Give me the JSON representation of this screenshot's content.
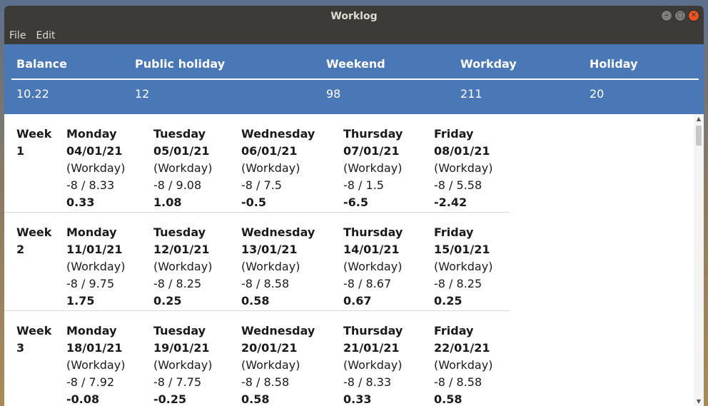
{
  "window": {
    "title": "Worklog"
  },
  "menu": {
    "file": "File",
    "edit": "Edit"
  },
  "summary": {
    "headers": [
      "Balance",
      "Public holiday",
      "Weekend",
      "Workday",
      "Holiday"
    ],
    "values": [
      "10.22",
      "12",
      "98",
      "211",
      "20"
    ]
  },
  "weeks": [
    {
      "label": "Week",
      "number": "1",
      "days": [
        {
          "name": "Monday",
          "date": "04/01/21",
          "type": "(Workday)",
          "hours": "-8 / 8.33",
          "balance": "0.33"
        },
        {
          "name": "Tuesday",
          "date": "05/01/21",
          "type": "(Workday)",
          "hours": "-8 / 9.08",
          "balance": "1.08"
        },
        {
          "name": "Wednesday",
          "date": "06/01/21",
          "type": "(Workday)",
          "hours": "-8 / 7.5",
          "balance": "-0.5"
        },
        {
          "name": "Thursday",
          "date": "07/01/21",
          "type": "(Workday)",
          "hours": "-8 / 1.5",
          "balance": "-6.5"
        },
        {
          "name": "Friday",
          "date": "08/01/21",
          "type": "(Workday)",
          "hours": "-8 / 5.58",
          "balance": "-2.42"
        }
      ]
    },
    {
      "label": "Week",
      "number": "2",
      "days": [
        {
          "name": "Monday",
          "date": "11/01/21",
          "type": "(Workday)",
          "hours": "-8 / 9.75",
          "balance": "1.75"
        },
        {
          "name": "Tuesday",
          "date": "12/01/21",
          "type": "(Workday)",
          "hours": "-8 / 8.25",
          "balance": "0.25"
        },
        {
          "name": "Wednesday",
          "date": "13/01/21",
          "type": "(Workday)",
          "hours": "-8 / 8.58",
          "balance": "0.58"
        },
        {
          "name": "Thursday",
          "date": "14/01/21",
          "type": "(Workday)",
          "hours": "-8 / 8.67",
          "balance": "0.67"
        },
        {
          "name": "Friday",
          "date": "15/01/21",
          "type": "(Workday)",
          "hours": "-8 / 8.25",
          "balance": "0.25"
        }
      ]
    },
    {
      "label": "Week",
      "number": "3",
      "days": [
        {
          "name": "Monday",
          "date": "18/01/21",
          "type": "(Workday)",
          "hours": "-8 / 7.92",
          "balance": "-0.08"
        },
        {
          "name": "Tuesday",
          "date": "19/01/21",
          "type": "(Workday)",
          "hours": "-8 / 7.75",
          "balance": "-0.25"
        },
        {
          "name": "Wednesday",
          "date": "20/01/21",
          "type": "(Workday)",
          "hours": "-8 / 8.58",
          "balance": "0.58"
        },
        {
          "name": "Thursday",
          "date": "21/01/21",
          "type": "(Workday)",
          "hours": "-8 / 8.33",
          "balance": "0.33"
        },
        {
          "name": "Friday",
          "date": "22/01/21",
          "type": "(Workday)",
          "hours": "-8 / 8.58",
          "balance": "0.58"
        }
      ]
    }
  ]
}
